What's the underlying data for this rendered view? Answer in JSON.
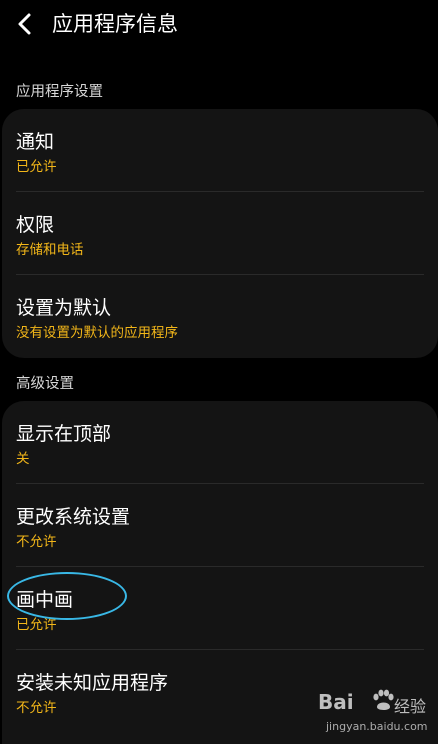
{
  "header": {
    "back_icon": "back-arrow-icon",
    "title": "应用程序信息"
  },
  "sections": [
    {
      "header": "应用程序设置",
      "items": [
        {
          "title": "通知",
          "subtitle": "已允许"
        },
        {
          "title": "权限",
          "subtitle": "存储和电话"
        },
        {
          "title": "设置为默认",
          "subtitle": "没有设置为默认的应用程序"
        }
      ]
    },
    {
      "header": "高级设置",
      "items": [
        {
          "title": "显示在顶部",
          "subtitle": "关"
        },
        {
          "title": "更改系统设置",
          "subtitle": "不允许"
        },
        {
          "title": "画中画",
          "subtitle": "已允许"
        },
        {
          "title": "安装未知应用程序",
          "subtitle": "不允许"
        }
      ]
    }
  ],
  "annotation": {
    "highlight_color": "#39b8e6"
  },
  "watermark": {
    "brand": "Bai",
    "brand_suffix": "经验",
    "url": "jingyan.baidu.com"
  },
  "colors": {
    "background": "#000000",
    "card": "#141414",
    "subtitle_accent": "#f2b619",
    "text_primary": "#ffffff"
  }
}
